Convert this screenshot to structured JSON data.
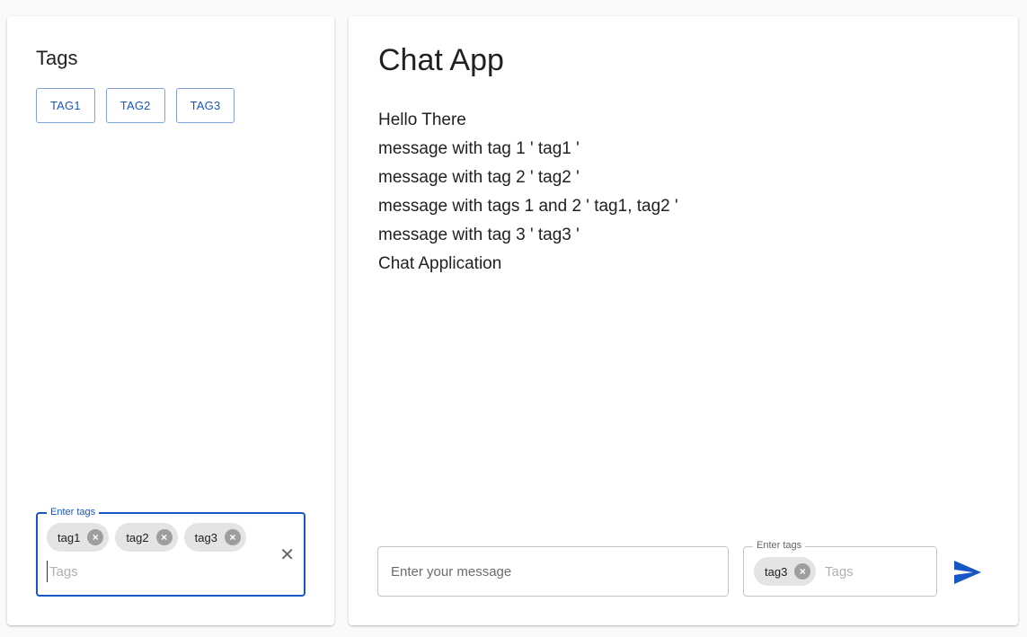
{
  "tags_panel": {
    "title": "Tags",
    "buttons": [
      "TAG1",
      "TAG2",
      "TAG3"
    ],
    "field": {
      "legend": "Enter tags",
      "chips": [
        "tag1",
        "tag2",
        "tag3"
      ],
      "placeholder": "Tags",
      "clear_icon": "close-icon"
    }
  },
  "chat": {
    "title": "Chat App",
    "messages": [
      "Hello There",
      "message with tag 1 ' tag1 '",
      "message with tag 2 ' tag2 '",
      "message with tags 1 and 2 ' tag1, tag2 '",
      "message with tag 3 ' tag3 '",
      "Chat Application"
    ],
    "composer": {
      "message_placeholder": "Enter your message",
      "tags_legend": "Enter tags",
      "tags_chips": [
        "tag3"
      ],
      "tags_placeholder": "Tags",
      "send_icon": "send-icon"
    }
  },
  "colors": {
    "primary": "#1656c5",
    "chip_bg": "#e4e4e4"
  }
}
